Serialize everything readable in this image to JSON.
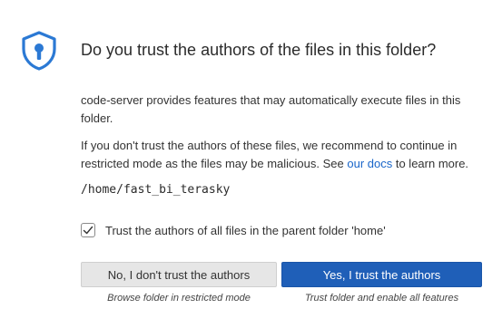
{
  "dialog": {
    "title": "Do you trust the authors of the files in this folder?",
    "paragraph1": "code-server provides features that may automatically execute files in this folder.",
    "paragraph2_before": "If you don't trust the authors of these files, we recommend to continue in restricted mode as the files may be malicious. See ",
    "paragraph2_link": "our docs",
    "paragraph2_after": " to learn more.",
    "folder_path": "/home/fast_bi_terasky",
    "checkbox": {
      "label": "Trust the authors of all files in the parent folder 'home'",
      "checked": true
    },
    "buttons": {
      "no_label": "No, I don't trust the authors",
      "yes_label": "Yes, I trust the authors",
      "no_caption": "Browse folder in restricted mode",
      "yes_caption": "Trust folder and enable all features"
    }
  },
  "colors": {
    "accent": "#1f5fb8",
    "link": "#1a66c9",
    "shield": "#2b79d4"
  },
  "icons": {
    "header": "shield-lock-icon",
    "checkbox": "checkmark-icon"
  }
}
